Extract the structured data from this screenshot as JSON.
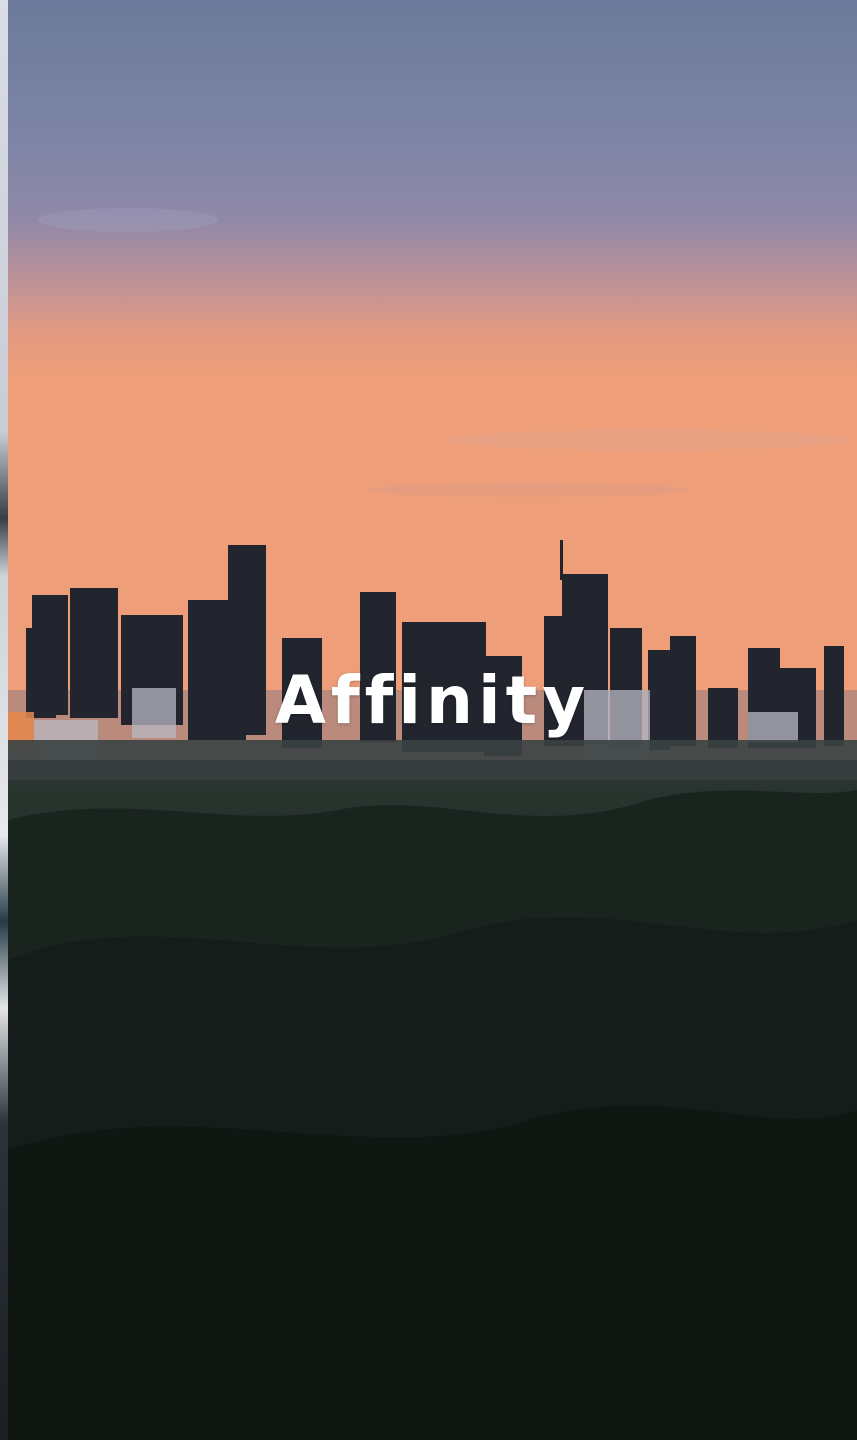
{
  "app": {
    "brand_title": "Affinity"
  },
  "background": {
    "description_icon": "city-skyline-sunset-icon",
    "colors": {
      "sky_top": "#6e7a9a",
      "sky_mid": "#8c87a8",
      "sky_horizon": "#e99a78",
      "buildings": "#20232c",
      "hills": "#1c261f"
    }
  },
  "colors": {
    "title_text": "#ffffff",
    "edge_strip": "#d9dde4"
  }
}
